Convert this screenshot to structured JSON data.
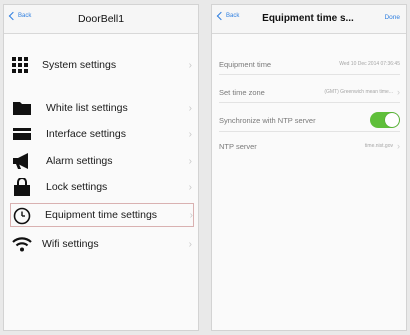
{
  "left_screen": {
    "back_label": "Back",
    "title": "DoorBell1",
    "items": [
      {
        "label": "System settings",
        "icon": "grid-icon"
      },
      {
        "label": "White list settings",
        "icon": "folder-icon"
      },
      {
        "label": "Interface settings",
        "icon": "card-icon"
      },
      {
        "label": "Alarm settings",
        "icon": "megaphone-icon"
      },
      {
        "label": "Lock settings",
        "icon": "lock-box-icon"
      },
      {
        "label": "Equipment time settings",
        "icon": "clock-icon",
        "selected": true
      },
      {
        "label": "Wifi settings",
        "icon": "wifi-icon"
      }
    ]
  },
  "right_screen": {
    "back_label": "Back",
    "title": "Equipment time s...",
    "done_label": "Done",
    "equipment_time": {
      "label": "Equipment time",
      "value": "Wed 10 Dec 2014 07:36:45"
    },
    "time_zone": {
      "label": "Set time zone",
      "value": "(GMT) Greenwich mean time..."
    },
    "ntp_sync": {
      "label": "Synchronize with NTP server",
      "on": true
    },
    "ntp_server": {
      "label": "NTP server",
      "value": "time.nist.gov"
    }
  },
  "colors": {
    "accent": "#2f7fe0",
    "toggle_on": "#5fbf3a"
  }
}
